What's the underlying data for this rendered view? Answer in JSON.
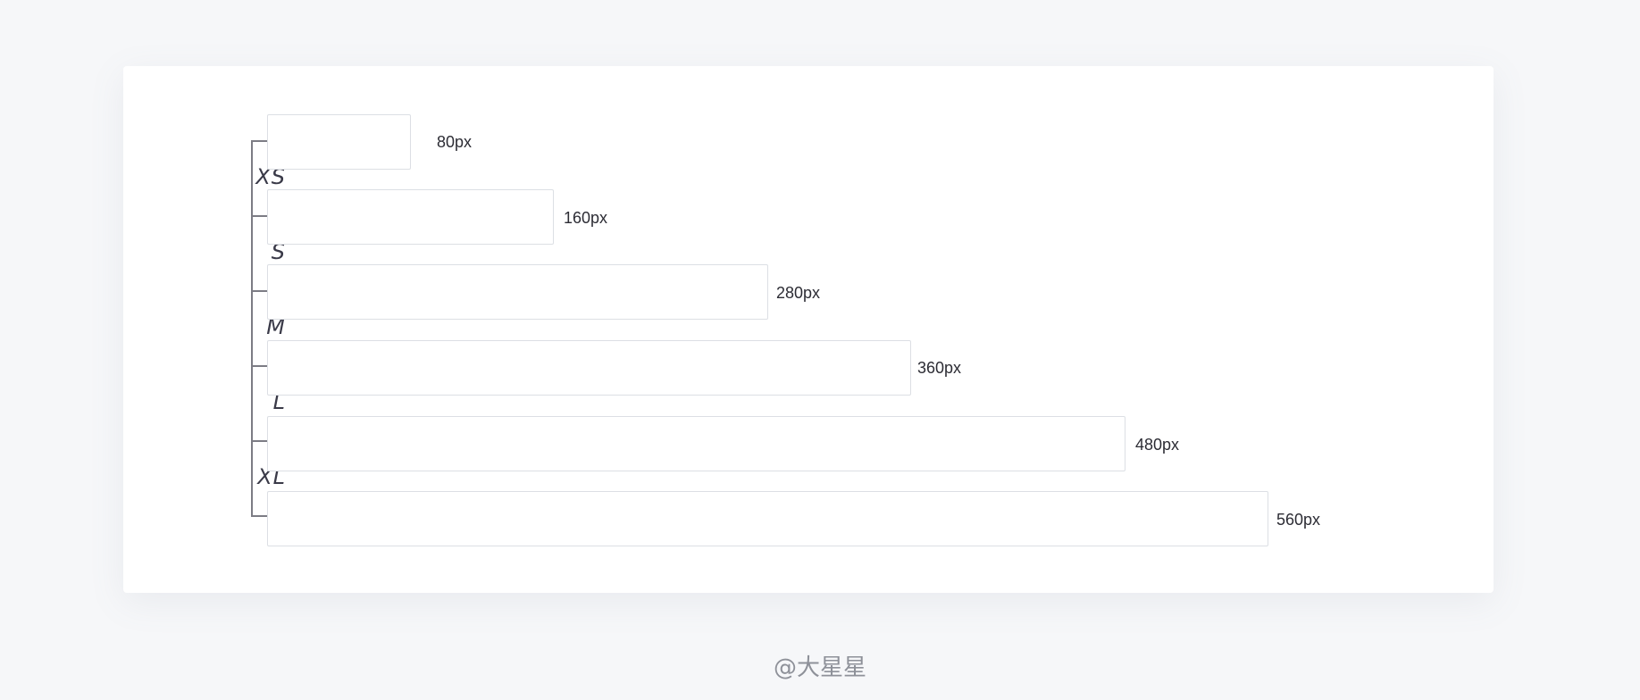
{
  "sizes": [
    {
      "label": "XS"
    },
    {
      "label": "S"
    },
    {
      "label": "M"
    },
    {
      "label": "L"
    },
    {
      "label": "XL"
    }
  ],
  "fields": [
    {
      "width_value": 80,
      "width_label": "80px"
    },
    {
      "width_value": 160,
      "width_label": "160px"
    },
    {
      "width_value": 280,
      "width_label": "280px"
    },
    {
      "width_value": 360,
      "width_label": "360px"
    },
    {
      "width_value": 480,
      "width_label": "480px"
    },
    {
      "width_value": 560,
      "width_label": "560px"
    }
  ],
  "colors": {
    "background": "#f6f7f9",
    "card": "#ffffff",
    "box_border": "#dcdfe4",
    "bracket": "#7c7c84",
    "size_label": "#3a3a48",
    "width_label": "#2c2c34",
    "watermark": "#8e9199"
  },
  "footer": {
    "watermark": "@大星星"
  }
}
